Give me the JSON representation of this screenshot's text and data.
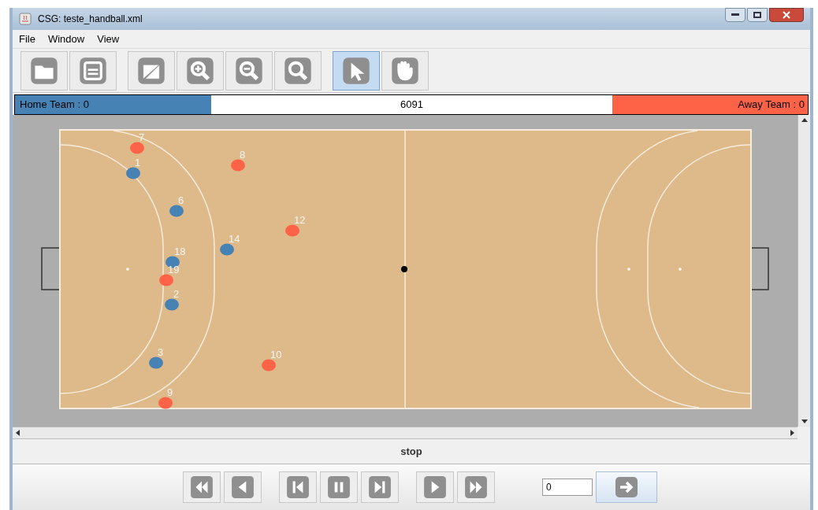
{
  "window": {
    "title": "CSG: teste_handball.xml"
  },
  "menu": [
    "File",
    "Window",
    "View"
  ],
  "toolbar": {
    "file_tools": [
      {
        "kind": "open"
      },
      {
        "kind": "save"
      }
    ],
    "view_tools": [
      {
        "kind": "fit"
      },
      {
        "kind": "zoom_in"
      },
      {
        "kind": "zoom_out"
      },
      {
        "kind": "zoom"
      }
    ],
    "mode_tools": [
      {
        "kind": "pointer",
        "selected": true
      },
      {
        "kind": "hand",
        "selected": false
      }
    ]
  },
  "scoreboard": {
    "home": "Home Team : 0",
    "time": "6091",
    "away": "Away Team : 0"
  },
  "players": [
    {
      "number": "7",
      "color": "#ff6347"
    },
    {
      "number": "1",
      "color": "#4682b4"
    },
    {
      "number": "8",
      "color": "#ff6347"
    },
    {
      "number": "6",
      "color": "#4682b4"
    },
    {
      "number": "12",
      "color": "#ff6347"
    },
    {
      "number": "14",
      "color": "#4682b4"
    },
    {
      "number": "18",
      "color": "#4682b4"
    },
    {
      "number": "19",
      "color": "#ff6347"
    },
    {
      "number": "2",
      "color": "#4682b4"
    },
    {
      "number": "3",
      "color": "#4682b4"
    },
    {
      "number": "10",
      "color": "#ff6347"
    },
    {
      "number": "9",
      "color": "#ff6347"
    }
  ],
  "status": "stop",
  "playback": [
    {
      "kind": "fast_back"
    },
    {
      "kind": "back"
    },
    {
      "kind": "first"
    },
    {
      "kind": "pause"
    },
    {
      "kind": "last"
    },
    {
      "kind": "play"
    },
    {
      "kind": "fast_forward"
    }
  ],
  "frame_field": {
    "value": "0"
  }
}
